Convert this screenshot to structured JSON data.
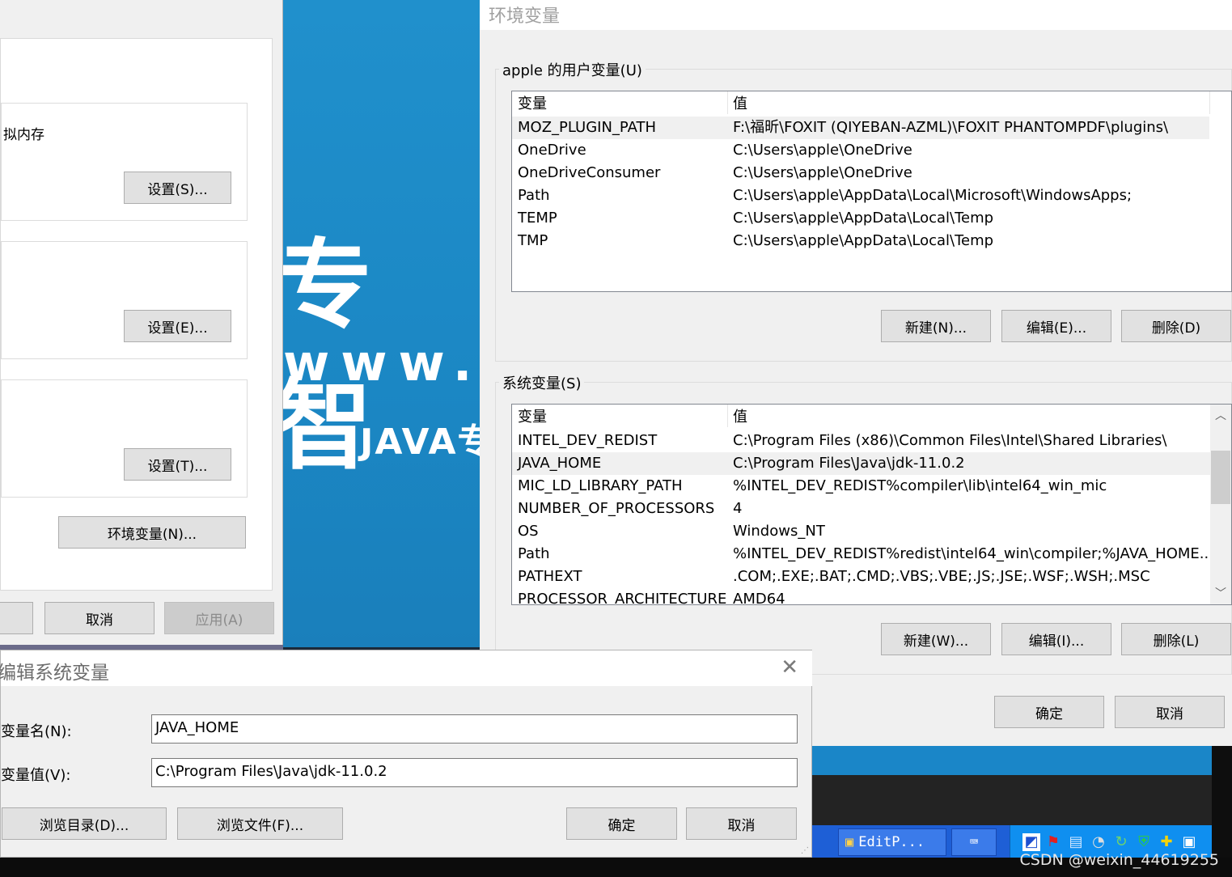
{
  "desktop_watermark": {
    "line1": "专 智",
    "line2": "www.itc",
    "line3": "JAVA专"
  },
  "system_properties": {
    "virtual_memory_text": "拟内存",
    "settings_s": "设置(S)...",
    "settings_e": "设置(E)...",
    "settings_t": "设置(T)...",
    "env_vars": "环境变量(N)...",
    "cancel": "取消",
    "apply": "应用(A)"
  },
  "env_window": {
    "title": "环境变量",
    "user_section": "apple 的用户变量(U)",
    "system_section": "系统变量(S)",
    "col_var": "变量",
    "col_val": "值",
    "user_vars": [
      {
        "name": "MOZ_PLUGIN_PATH",
        "value": "F:\\福昕\\FOXIT (QIYEBAN-AZML)\\FOXIT PHANTOMPDF\\plugins\\"
      },
      {
        "name": "OneDrive",
        "value": "C:\\Users\\apple\\OneDrive"
      },
      {
        "name": "OneDriveConsumer",
        "value": "C:\\Users\\apple\\OneDrive"
      },
      {
        "name": "Path",
        "value": "C:\\Users\\apple\\AppData\\Local\\Microsoft\\WindowsApps;"
      },
      {
        "name": "TEMP",
        "value": "C:\\Users\\apple\\AppData\\Local\\Temp"
      },
      {
        "name": "TMP",
        "value": "C:\\Users\\apple\\AppData\\Local\\Temp"
      }
    ],
    "system_vars": [
      {
        "name": "INTEL_DEV_REDIST",
        "value": "C:\\Program Files (x86)\\Common Files\\Intel\\Shared Libraries\\"
      },
      {
        "name": "JAVA_HOME",
        "value": "C:\\Program Files\\Java\\jdk-11.0.2"
      },
      {
        "name": "MIC_LD_LIBRARY_PATH",
        "value": "%INTEL_DEV_REDIST%compiler\\lib\\intel64_win_mic"
      },
      {
        "name": "NUMBER_OF_PROCESSORS",
        "value": "4"
      },
      {
        "name": "OS",
        "value": "Windows_NT"
      },
      {
        "name": "Path",
        "value": "%INTEL_DEV_REDIST%redist\\intel64_win\\compiler;%JAVA_HOME..."
      },
      {
        "name": "PATHEXT",
        "value": ".COM;.EXE;.BAT;.CMD;.VBS;.VBE;.JS;.JSE;.WSF;.WSH;.MSC"
      },
      {
        "name": "PROCESSOR_ARCHITECTURE",
        "value": "AMD64"
      }
    ],
    "user_new": "新建(N)...",
    "user_edit": "编辑(E)...",
    "user_delete": "删除(D)",
    "sys_new": "新建(W)...",
    "sys_edit": "编辑(I)...",
    "sys_delete": "删除(L)",
    "ok": "确定",
    "cancel": "取消"
  },
  "edit_dialog": {
    "title": "编辑系统变量",
    "name_label": "变量名(N):",
    "value_label": "变量值(V):",
    "name_value": "JAVA_HOME",
    "value_value": "C:\\Program Files\\Java\\jdk-11.0.2",
    "browse_dir": "浏览目录(D)...",
    "browse_file": "浏览文件(F)...",
    "ok": "确定",
    "cancel": "取消"
  },
  "taskbar": {
    "app_label": "EditP..."
  },
  "watermark": "CSDN @weixin_44619255"
}
